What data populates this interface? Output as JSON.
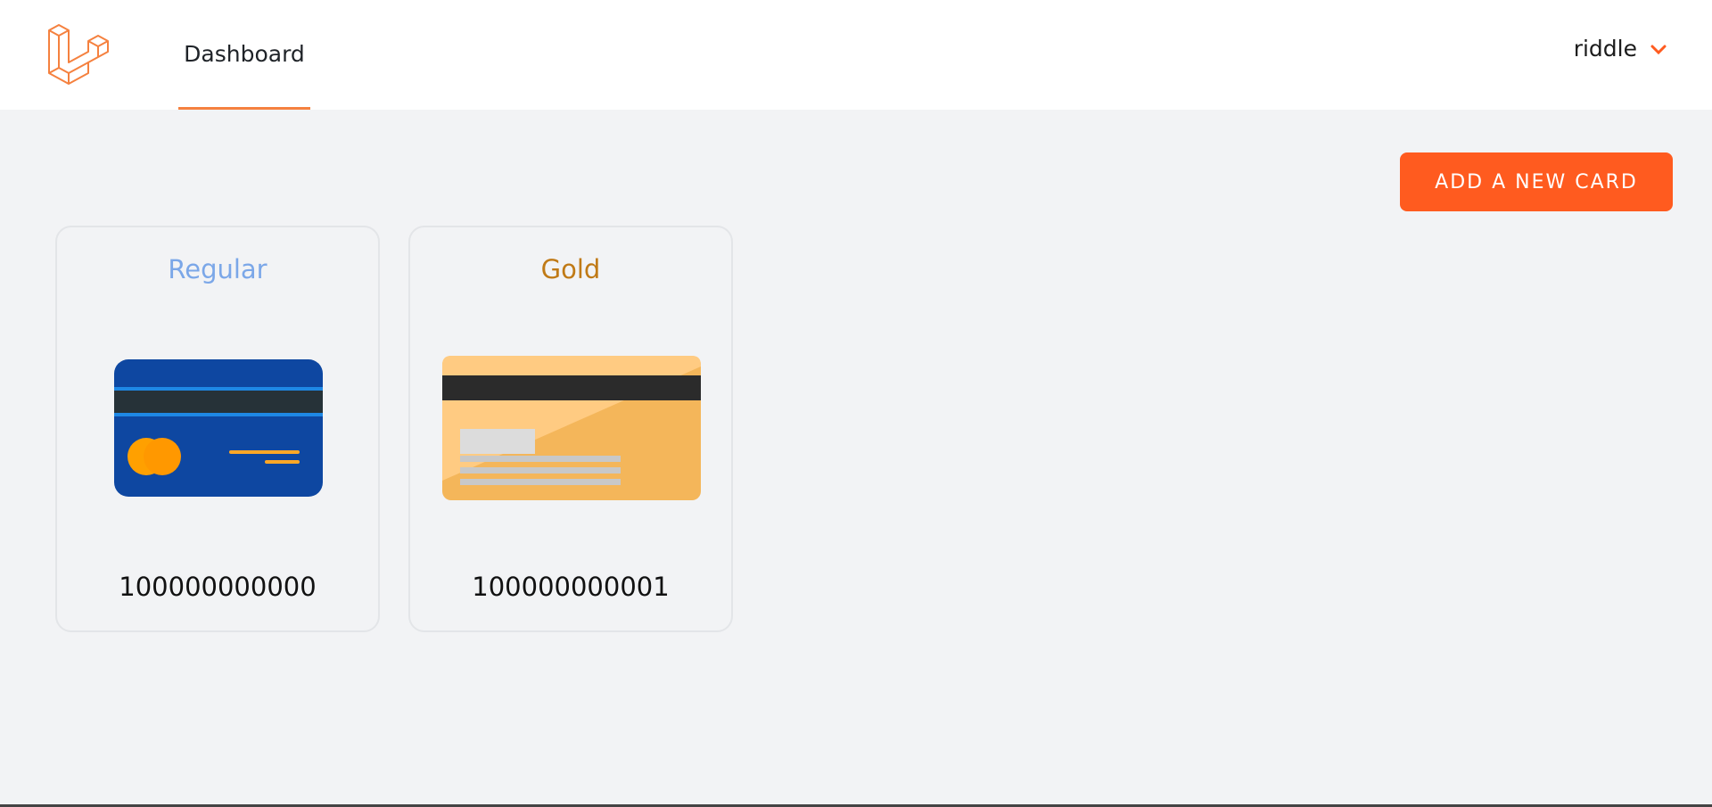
{
  "nav": {
    "tab_dashboard": "Dashboard",
    "user_name": "riddle",
    "logo_icon": "laravel-logo-icon",
    "dropdown_icon": "chevron-down-icon",
    "accent_color": "#f5813f"
  },
  "actions": {
    "add_card_label": "ADD A NEW CARD",
    "add_card_color": "#ff5b1f"
  },
  "cards": [
    {
      "type": "Regular",
      "type_color": "#7ba7e8",
      "number": "100000000000",
      "icon": "blue-credit-card-icon"
    },
    {
      "type": "Gold",
      "type_color": "#c07a16",
      "number": "100000000001",
      "icon": "gold-credit-card-icon"
    }
  ]
}
